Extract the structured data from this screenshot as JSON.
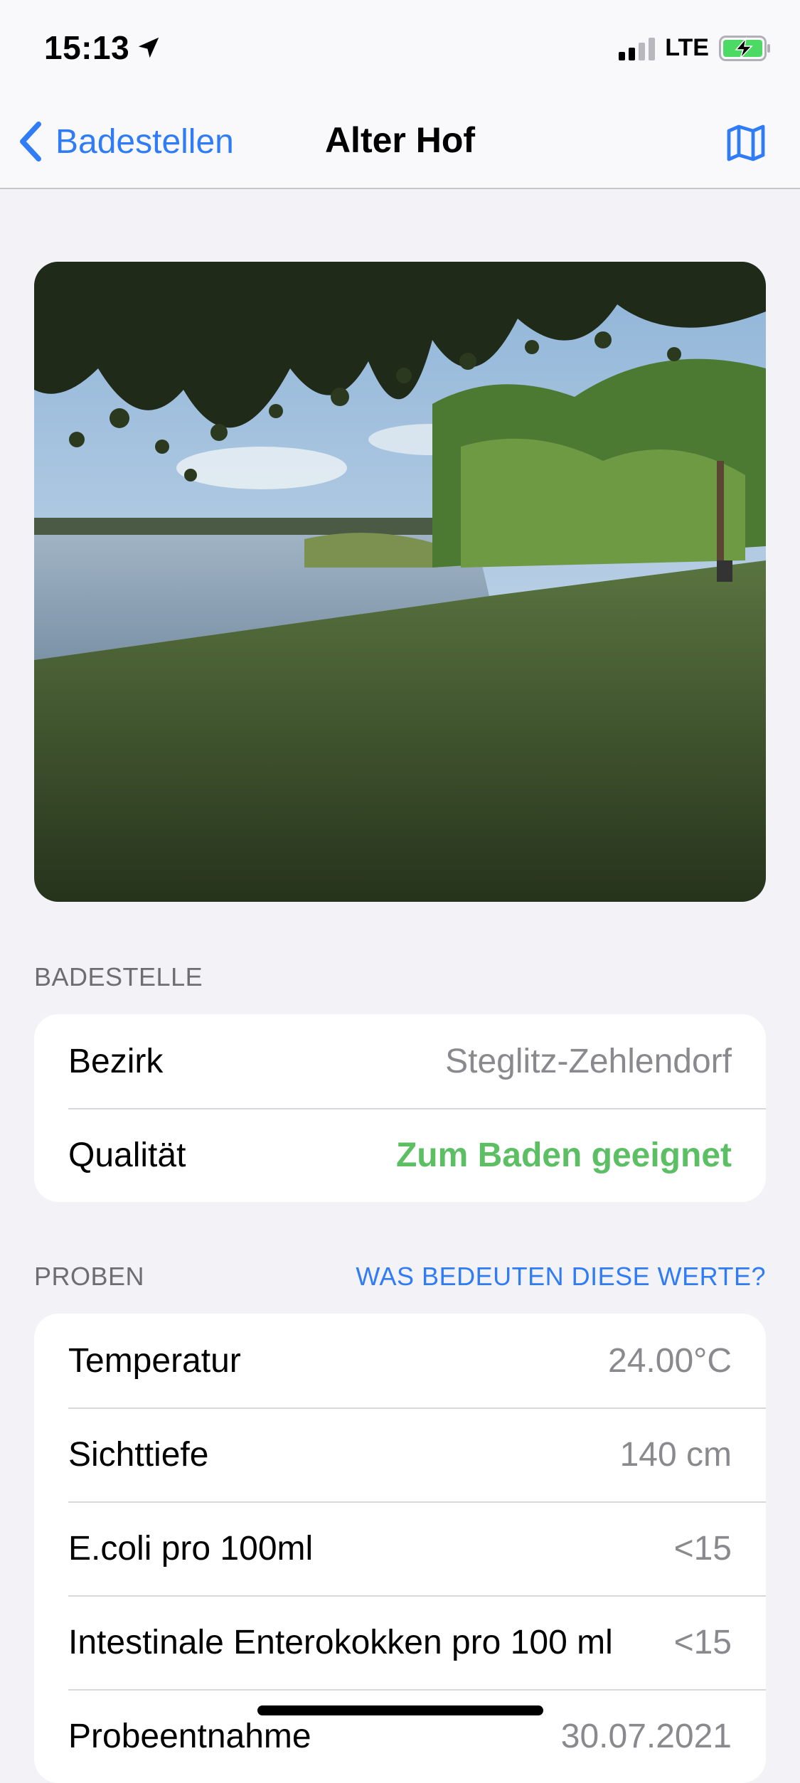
{
  "status": {
    "time": "15:13",
    "network": "LTE",
    "icons": [
      "location-arrow-icon",
      "signal-icon",
      "battery-charging-icon"
    ]
  },
  "nav": {
    "back_label": "Badestellen",
    "title": "Alter Hof",
    "right_icon": "map-icon",
    "accent": "#2f7cf6"
  },
  "sections": {
    "badestelle": {
      "header": "BADESTELLE",
      "rows": [
        {
          "label": "Bezirk",
          "value": "Steglitz-Zehlendorf"
        },
        {
          "label": "Qualität",
          "value": "Zum Baden geeignet"
        }
      ]
    },
    "proben": {
      "header": "PROBEN",
      "link": "WAS BEDEUTEN DIESE WERTE?",
      "rows": [
        {
          "label": "Temperatur",
          "value": "24.00°C"
        },
        {
          "label": "Sichttiefe",
          "value": "140 cm"
        },
        {
          "label": "E.coli pro 100ml",
          "value": "<15"
        },
        {
          "label": "Intestinale Enterokokken pro 100 ml",
          "value": "<15"
        },
        {
          "label": "Probeentnahme",
          "value": "30.07.2021"
        }
      ]
    }
  },
  "colors": {
    "good_quality": "#5cbf64",
    "secondary_text": "#8a8a8e",
    "background": "#f2f2f7"
  }
}
